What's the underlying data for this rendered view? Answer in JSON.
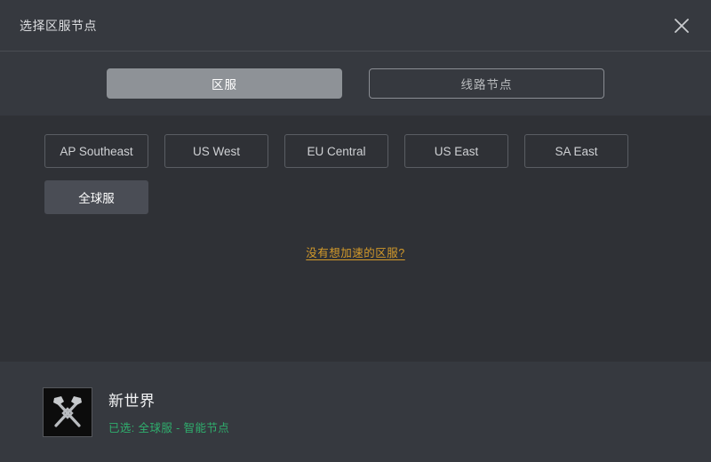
{
  "window": {
    "title": "选择区服节点",
    "close_icon": "close-icon"
  },
  "tabs": [
    {
      "label": "区服",
      "state": "active"
    },
    {
      "label": "线路节点",
      "state": "inactive"
    }
  ],
  "regions": [
    {
      "label": "AP Southeast",
      "selected": false
    },
    {
      "label": "US West",
      "selected": false
    },
    {
      "label": "EU Central",
      "selected": false
    },
    {
      "label": "US East",
      "selected": false
    },
    {
      "label": "SA East",
      "selected": false
    },
    {
      "label": "全球服",
      "selected": true
    }
  ],
  "missing_region_link": "没有想加速的区服?",
  "footer": {
    "game_icon": "crossed-axes-icon",
    "game_name": "新世界",
    "status": "已选: 全球服 - 智能节点"
  },
  "colors": {
    "header_bg": "#36393f",
    "content_bg": "#2f3136",
    "active_tab": "#8e9297",
    "link": "#d49a2a",
    "status_green": "#2fae6d",
    "border": "#5a5d63"
  }
}
